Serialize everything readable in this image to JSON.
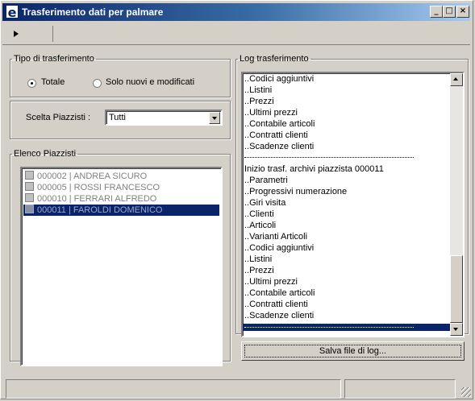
{
  "window": {
    "title": "Trasferimento dati per palmare",
    "app_icon_glyph": "e",
    "controls": {
      "minimize": "_",
      "maximize": "□",
      "close": "×"
    }
  },
  "transfer_type": {
    "legend": "Tipo di trasferimento",
    "options": [
      {
        "label": "Totale",
        "checked": true
      },
      {
        "label": "Solo nuovi e modificati",
        "checked": false
      }
    ]
  },
  "piazzisti_choice": {
    "label": "Scelta Piazzisti :",
    "selected": "Tutti"
  },
  "piazzisti_list": {
    "legend": "Elenco Piazzisti",
    "items": [
      {
        "label": "000002 | ANDREA SICURO",
        "selected": false
      },
      {
        "label": "000005 | ROSSI FRANCESCO",
        "selected": false
      },
      {
        "label": "000010 | FERRARI ALFREDO",
        "selected": false
      },
      {
        "label": "000011 | FAROLDI DOMENICO",
        "selected": true
      }
    ]
  },
  "log": {
    "legend": "Log trasferimento",
    "lines_top": [
      "..Codici aggiuntivi",
      "..Listini",
      "..Prezzi",
      "..Ultimi prezzi",
      "..Contabile articoli",
      "..Contratti clienti",
      "..Scadenze clienti"
    ],
    "lines_bottom": [
      "Inizio trasf. archivi piazzista 000011",
      "..Parametri",
      "..Progressivi numerazione",
      "..Giri visita",
      "..Clienti",
      "..Articoli",
      "..Varianti Articoli",
      "..Codici aggiuntivi",
      "..Listini",
      "..Prezzi",
      "..Ultimi prezzi",
      "..Contabile articoli",
      "..Contratti clienti",
      "..Scadenze clienti"
    ]
  },
  "save_button": {
    "label": "Salva file di log..."
  },
  "colors": {
    "face": "#d4d0c8",
    "selection": "#0a246a",
    "title_start": "#0a246a",
    "title_end": "#a6caf0"
  }
}
